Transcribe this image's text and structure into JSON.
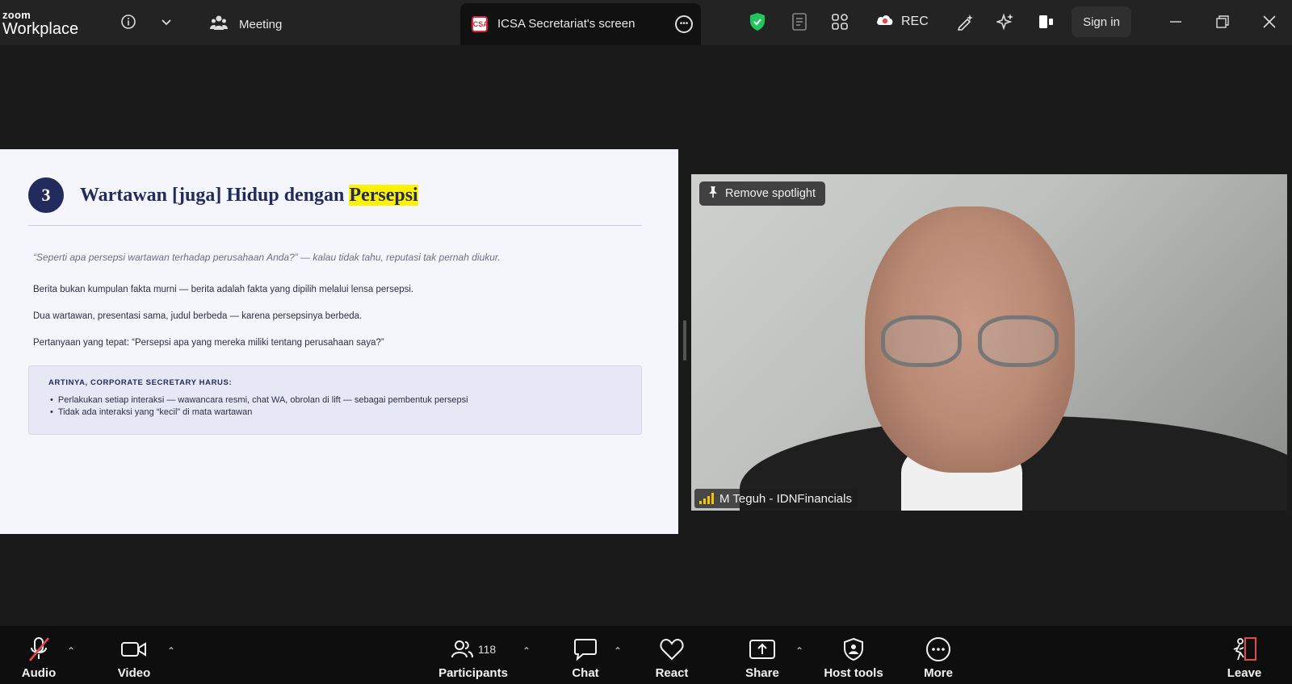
{
  "topbar": {
    "logo_small": "zoom",
    "logo_big": "Workplace",
    "meeting_label": "Meeting",
    "shared_screen_label": "ICSA Secretariat's screen",
    "shared_badge": "ICSA",
    "rec_label": "REC",
    "signin_label": "Sign in"
  },
  "slide": {
    "number": "3",
    "title_main": "Wartawan [juga] Hidup dengan ",
    "title_highlight": "Persepsi",
    "quote": "“Seperti apa persepsi wartawan terhadap perusahaan Anda?” — kalau tidak tahu, reputasi tak pernah diukur.",
    "paragraphs": [
      "Berita bukan kumpulan fakta murni — berita adalah fakta yang dipilih melalui lensa persepsi.",
      "Dua wartawan, presentasi sama, judul berbeda — karena persepsinya berbeda.",
      "Pertanyaan yang tepat: “Persepsi apa yang mereka miliki tentang perusahaan saya?”"
    ],
    "box_heading": "ARTINYA, CORPORATE SECRETARY HARUS:",
    "box_items": [
      "Perlakukan setiap interaksi — wawancara resmi, chat WA, obrolan di lift — sebagai pembentuk persepsi",
      "Tidak ada interaksi yang “kecil” di mata wartawan"
    ]
  },
  "video": {
    "spotlight_label": "Remove spotlight",
    "participant_name": "M Teguh - IDNFinancials"
  },
  "toolbar": {
    "audio": "Audio",
    "video": "Video",
    "participants": "Participants",
    "participants_count": "118",
    "chat": "Chat",
    "react": "React",
    "share": "Share",
    "host_tools": "Host tools",
    "more": "More",
    "leave": "Leave"
  },
  "colors": {
    "slide_navy": "#232a5c",
    "highlight": "#fff200",
    "shield_green": "#22c55e",
    "rec_red": "#e5484d",
    "signal_yellow": "#f5c400"
  }
}
